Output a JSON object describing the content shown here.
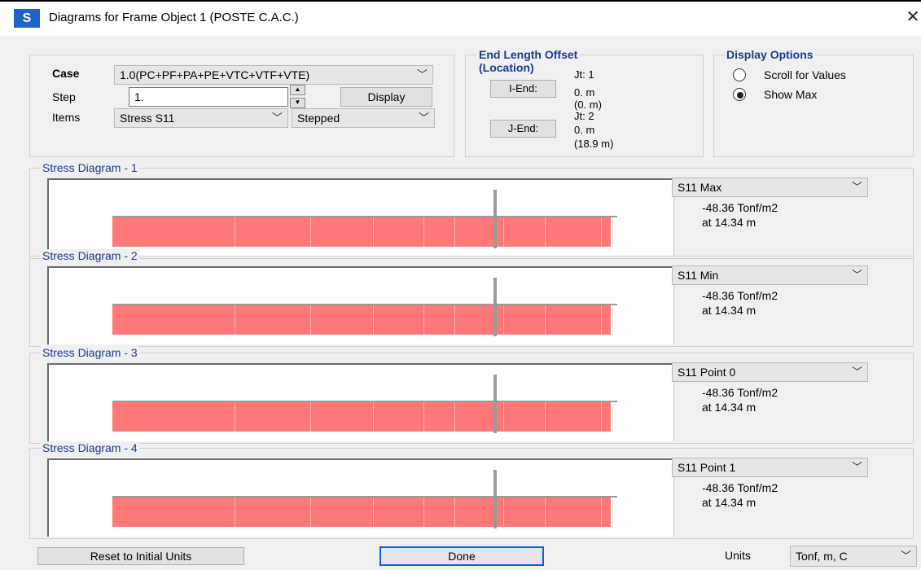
{
  "window": {
    "icon_letter": "S",
    "title": "Diagrams for Frame Object 1  (POSTE C.A.C.)",
    "close": "✕"
  },
  "controls": {
    "case_label": "Case",
    "case_value": "1.0(PC+PF+PA+PE+VTC+VTF+VTE)",
    "step_label": "Step",
    "step_value": "1.",
    "items_label": "Items",
    "items_value": "Stress S11",
    "mode_value": "Stepped",
    "display_button": "Display"
  },
  "end_offset": {
    "title_line1": "End Length Offset",
    "title_line2": "(Location)",
    "iend_button": "I-End:",
    "iend_jt": "Jt:  1",
    "iend_len": "0.  m",
    "iend_loc": "(0.  m)",
    "jend_button": "J-End:",
    "jend_jt": "Jt:  2",
    "jend_len": "0.  m",
    "jend_loc": "(18.9  m)"
  },
  "display_options": {
    "title": "Display Options",
    "options": [
      {
        "label": "Scroll for Values",
        "checked": false
      },
      {
        "label": "Show Max",
        "checked": true
      }
    ]
  },
  "diagrams": [
    {
      "title": "Stress Diagram - 1",
      "select": "S11 Max",
      "value": "-48.36 Tonf/m2",
      "location": "at 14.34 m"
    },
    {
      "title": "Stress Diagram - 2",
      "select": "S11 Min",
      "value": "-48.36 Tonf/m2",
      "location": "at 14.34 m"
    },
    {
      "title": "Stress Diagram - 3",
      "select": "S11 Point 0",
      "value": "-48.36 Tonf/m2",
      "location": "at 14.34 m"
    },
    {
      "title": "Stress Diagram - 4",
      "select": "S11 Point 1",
      "value": "-48.36 Tonf/m2",
      "location": "at 14.34 m"
    }
  ],
  "footer": {
    "reset_button": "Reset to Initial Units",
    "done_button": "Done",
    "units_label": "Units",
    "units_value": "Tonf, m, C"
  },
  "colors": {
    "diagram_fill": "#ff7878",
    "group_title": "#1d3a8c",
    "app_icon": "#1f63c8"
  }
}
